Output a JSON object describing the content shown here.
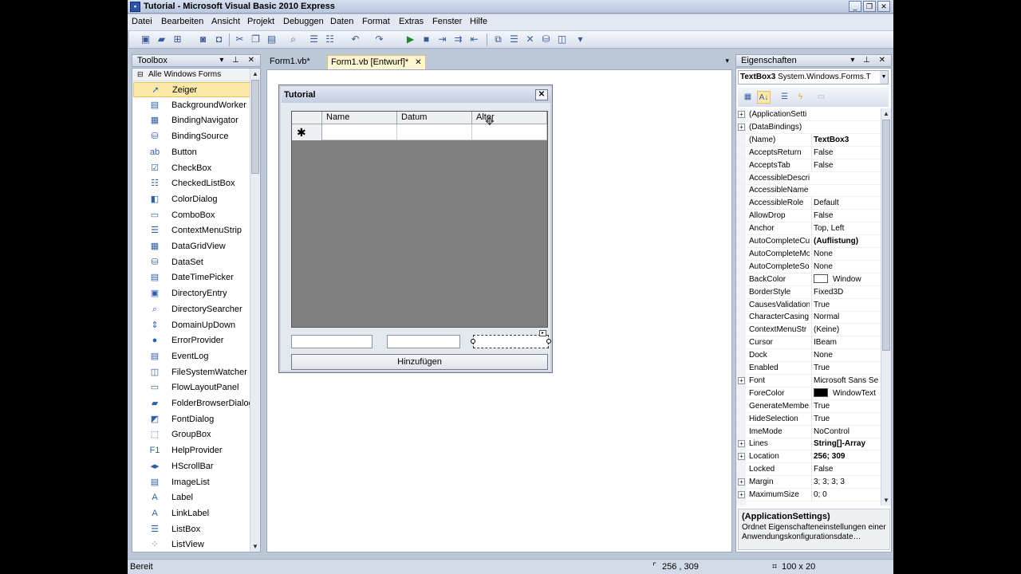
{
  "window": {
    "title": "Tutorial - Microsoft Visual Basic 2010 Express",
    "app_icon": "vb-icon",
    "buttons": [
      "_",
      "❐",
      "✕"
    ]
  },
  "menu": [
    "Datei",
    "Bearbeiten",
    "Ansicht",
    "Projekt",
    "Debuggen",
    "Daten",
    "Format",
    "Extras",
    "Fenster",
    "Hilfe"
  ],
  "toolbox": {
    "title": "Toolbox",
    "group": "Alle Windows Forms",
    "items": [
      {
        "label": "Zeiger",
        "icon": "pointer-icon",
        "glyph": "➚"
      },
      {
        "label": "BackgroundWorker",
        "icon": "background-worker-icon",
        "glyph": "▤"
      },
      {
        "label": "BindingNavigator",
        "icon": "binding-navigator-icon",
        "glyph": "▦"
      },
      {
        "label": "BindingSource",
        "icon": "binding-source-icon",
        "glyph": "⛁"
      },
      {
        "label": "Button",
        "icon": "button-icon",
        "glyph": "ab"
      },
      {
        "label": "CheckBox",
        "icon": "checkbox-icon",
        "glyph": "☑"
      },
      {
        "label": "CheckedListBox",
        "icon": "checked-listbox-icon",
        "glyph": "☷"
      },
      {
        "label": "ColorDialog",
        "icon": "color-dialog-icon",
        "glyph": "◧"
      },
      {
        "label": "ComboBox",
        "icon": "combobox-icon",
        "glyph": "▭"
      },
      {
        "label": "ContextMenuStrip",
        "icon": "context-menu-icon",
        "glyph": "☰"
      },
      {
        "label": "DataGridView",
        "icon": "datagridview-icon",
        "glyph": "▦"
      },
      {
        "label": "DataSet",
        "icon": "dataset-icon",
        "glyph": "⛁"
      },
      {
        "label": "DateTimePicker",
        "icon": "datetimepicker-icon",
        "glyph": "▤"
      },
      {
        "label": "DirectoryEntry",
        "icon": "directory-entry-icon",
        "glyph": "▣"
      },
      {
        "label": "DirectorySearcher",
        "icon": "directory-searcher-icon",
        "glyph": "⌕"
      },
      {
        "label": "DomainUpDown",
        "icon": "domain-updown-icon",
        "glyph": "⇕"
      },
      {
        "label": "ErrorProvider",
        "icon": "error-provider-icon",
        "glyph": "●"
      },
      {
        "label": "EventLog",
        "icon": "eventlog-icon",
        "glyph": "▤"
      },
      {
        "label": "FileSystemWatcher",
        "icon": "filesystemwatcher-icon",
        "glyph": "◫"
      },
      {
        "label": "FlowLayoutPanel",
        "icon": "flowlayoutpanel-icon",
        "glyph": "▭"
      },
      {
        "label": "FolderBrowserDialog",
        "icon": "folder-browser-icon",
        "glyph": "▰"
      },
      {
        "label": "FontDialog",
        "icon": "font-dialog-icon",
        "glyph": "◩"
      },
      {
        "label": "GroupBox",
        "icon": "groupbox-icon",
        "glyph": "⬚"
      },
      {
        "label": "HelpProvider",
        "icon": "help-provider-icon",
        "glyph": "F1"
      },
      {
        "label": "HScrollBar",
        "icon": "hscrollbar-icon",
        "glyph": "◂▸"
      },
      {
        "label": "ImageList",
        "icon": "imagelist-icon",
        "glyph": "▤"
      },
      {
        "label": "Label",
        "icon": "label-icon",
        "glyph": "A"
      },
      {
        "label": "LinkLabel",
        "icon": "linklabel-icon",
        "glyph": "A"
      },
      {
        "label": "ListBox",
        "icon": "listbox-icon",
        "glyph": "☰"
      },
      {
        "label": "ListView",
        "icon": "listview-icon",
        "glyph": "⁘"
      }
    ]
  },
  "tabs": [
    {
      "label": "Form1.vb*"
    },
    {
      "label": "Form1.vb [Entwurf]*",
      "close": "✕"
    }
  ],
  "form": {
    "title": "Tutorial",
    "close": "✕",
    "columns": [
      "Name",
      "Datum",
      "Alter"
    ],
    "new_row_marker": "✱",
    "button": "Hinzufügen"
  },
  "properties": {
    "title": "Eigenschaften",
    "object_name": "TextBox3",
    "object_type": "System.Windows.Forms.T",
    "rows": [
      {
        "name": "(ApplicationSetti",
        "value": "",
        "expand": "+"
      },
      {
        "name": "(DataBindings)",
        "value": "",
        "expand": "+"
      },
      {
        "name": "(Name)",
        "value": "TextBox3",
        "bold": true
      },
      {
        "name": "AcceptsReturn",
        "value": "False"
      },
      {
        "name": "AcceptsTab",
        "value": "False"
      },
      {
        "name": "AccessibleDescri",
        "value": ""
      },
      {
        "name": "AccessibleName",
        "value": ""
      },
      {
        "name": "AccessibleRole",
        "value": "Default"
      },
      {
        "name": "AllowDrop",
        "value": "False"
      },
      {
        "name": "Anchor",
        "value": "Top, Left"
      },
      {
        "name": "AutoCompleteCu",
        "value": "(Auflistung)",
        "bold": true
      },
      {
        "name": "AutoCompleteMo",
        "value": "None"
      },
      {
        "name": "AutoCompleteSo",
        "value": "None"
      },
      {
        "name": "BackColor",
        "value": "Window",
        "swatch": "#ffffff"
      },
      {
        "name": "BorderStyle",
        "value": "Fixed3D"
      },
      {
        "name": "CausesValidation",
        "value": "True"
      },
      {
        "name": "CharacterCasing",
        "value": "Normal"
      },
      {
        "name": "ContextMenuStr",
        "value": "(Keine)"
      },
      {
        "name": "Cursor",
        "value": "IBeam"
      },
      {
        "name": "Dock",
        "value": "None"
      },
      {
        "name": "Enabled",
        "value": "True"
      },
      {
        "name": "Font",
        "value": "Microsoft Sans Se",
        "expand": "+"
      },
      {
        "name": "ForeColor",
        "value": "WindowText",
        "swatch": "#000000"
      },
      {
        "name": "GenerateMembe",
        "value": "True"
      },
      {
        "name": "HideSelection",
        "value": "True"
      },
      {
        "name": "ImeMode",
        "value": "NoControl"
      },
      {
        "name": "Lines",
        "value": "String[]-Array",
        "bold": true,
        "expand": "+"
      },
      {
        "name": "Location",
        "value": "256; 309",
        "bold": true,
        "expand": "+"
      },
      {
        "name": "Locked",
        "value": "False"
      },
      {
        "name": "Margin",
        "value": "3; 3; 3; 3",
        "expand": "+"
      },
      {
        "name": "MaximumSize",
        "value": "0; 0",
        "expand": "+"
      }
    ],
    "description_title": "(ApplicationSettings)",
    "description_text": "Ordnet Eigenschafteneinstellungen einer Anwendungskonfigurationsdate…"
  },
  "status": {
    "text": "Bereit",
    "position": "256 , 309",
    "size": "100 x 20"
  }
}
